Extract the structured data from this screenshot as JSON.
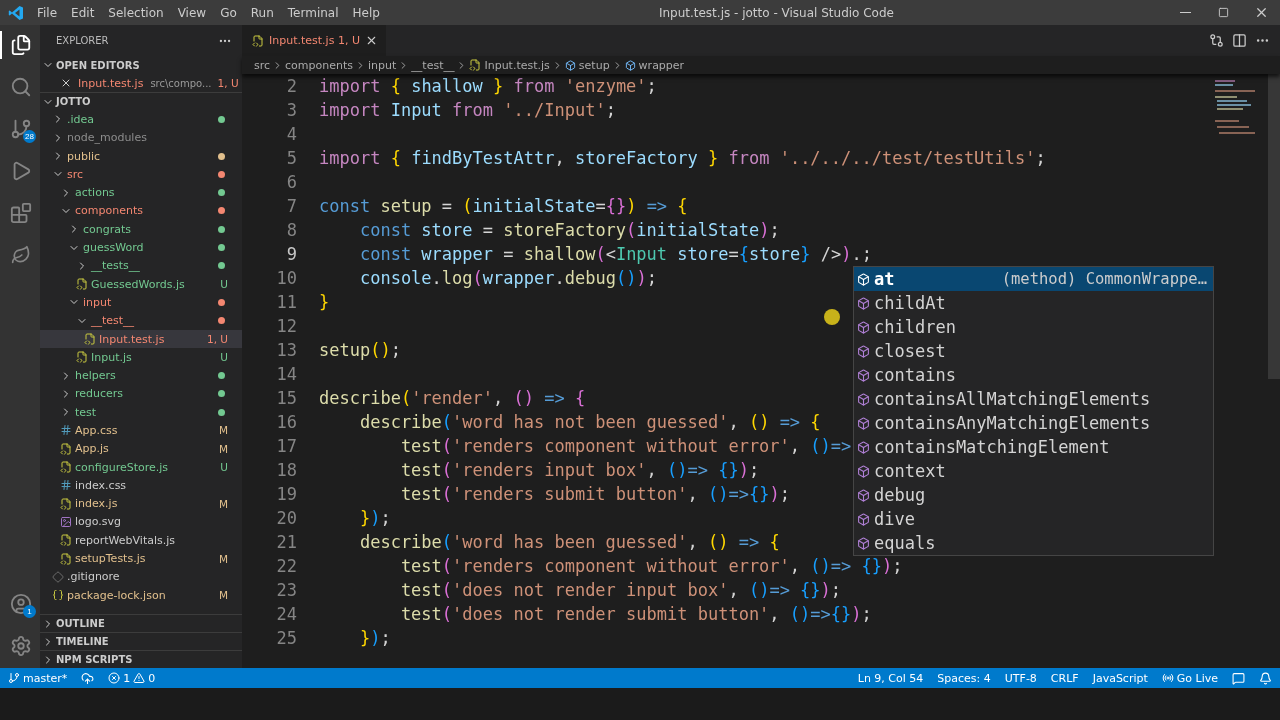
{
  "title_bar": {
    "menus": [
      "File",
      "Edit",
      "Selection",
      "View",
      "Go",
      "Run",
      "Terminal",
      "Help"
    ],
    "title": "Input.test.js - jotto - Visual Studio Code"
  },
  "activity_bar": {
    "source_control_badge": "28",
    "accounts_badge": "1"
  },
  "sidebar": {
    "title": "EXPLORER",
    "open_editors": {
      "label": "OPEN EDITORS",
      "expanded": true,
      "items": [
        {
          "name": "Input.test.js",
          "path": "src\\compo...",
          "badge": "1, U",
          "color": "#f48771"
        }
      ]
    },
    "project": {
      "label": "JOTTO",
      "expanded": true,
      "items": [
        {
          "name": ".idea",
          "kind": "folder",
          "expanded": false,
          "selected": false,
          "dot": true,
          "color": "#73c991"
        },
        {
          "name": "node_modules",
          "kind": "folder",
          "expanded": false,
          "selected": false,
          "dot": false,
          "color": "#8c8c8c"
        },
        {
          "name": "public",
          "kind": "folder",
          "expanded": false,
          "selected": false,
          "dot": true,
          "color": "#e2c08d"
        },
        {
          "name": "src",
          "kind": "folder",
          "expanded": true,
          "selected": false,
          "dot": true,
          "color": "#f48771",
          "children": [
            {
              "name": "actions",
              "kind": "folder",
              "expanded": false,
              "selected": false,
              "dot": true,
              "color": "#73c991"
            },
            {
              "name": "components",
              "kind": "folder",
              "expanded": true,
              "selected": false,
              "dot": true,
              "color": "#f48771",
              "children": [
                {
                  "name": "congrats",
                  "kind": "folder",
                  "expanded": false,
                  "selected": false,
                  "dot": true,
                  "color": "#73c991"
                },
                {
                  "name": "guessWord",
                  "kind": "folder",
                  "expanded": true,
                  "selected": false,
                  "dot": true,
                  "color": "#73c991",
                  "children": [
                    {
                      "name": "__tests__",
                      "kind": "folder",
                      "expanded": false,
                      "selected": false,
                      "dot": true,
                      "color": "#73c991"
                    },
                    {
                      "name": "GuessedWords.js",
                      "kind": "js",
                      "selected": false,
                      "dot": false,
                      "badge": "U",
                      "color": "#73c991"
                    }
                  ]
                },
                {
                  "name": "input",
                  "kind": "folder",
                  "expanded": true,
                  "selected": false,
                  "dot": true,
                  "color": "#f48771",
                  "children": [
                    {
                      "name": "__test__",
                      "kind": "folder",
                      "expanded": true,
                      "selected": false,
                      "dot": true,
                      "color": "#f48771",
                      "children": [
                        {
                          "name": "Input.test.js",
                          "kind": "js",
                          "selected": true,
                          "dot": false,
                          "badge": "1, U",
                          "color": "#f48771"
                        }
                      ]
                    },
                    {
                      "name": "Input.js",
                      "kind": "js",
                      "selected": false,
                      "dot": false,
                      "badge": "U",
                      "color": "#73c991"
                    }
                  ]
                }
              ]
            },
            {
              "name": "helpers",
              "kind": "folder",
              "expanded": false,
              "selected": false,
              "dot": true,
              "color": "#73c991"
            },
            {
              "name": "reducers",
              "kind": "folder",
              "expanded": false,
              "selected": false,
              "dot": true,
              "color": "#73c991"
            },
            {
              "name": "test",
              "kind": "folder",
              "expanded": false,
              "selected": false,
              "dot": true,
              "color": "#73c991"
            },
            {
              "name": "App.css",
              "kind": "css",
              "selected": false,
              "dot": false,
              "badge": "M",
              "color": "#e2c08d"
            },
            {
              "name": "App.js",
              "kind": "js",
              "selected": false,
              "dot": false,
              "badge": "M",
              "color": "#e2c08d"
            },
            {
              "name": "configureStore.js",
              "kind": "js",
              "selected": false,
              "dot": false,
              "badge": "U",
              "color": "#73c991"
            },
            {
              "name": "index.css",
              "kind": "css",
              "selected": false,
              "dot": false,
              "color": "#cccccc"
            },
            {
              "name": "index.js",
              "kind": "js",
              "selected": false,
              "dot": false,
              "badge": "M",
              "color": "#e2c08d"
            },
            {
              "name": "logo.svg",
              "kind": "svg",
              "selected": false,
              "dot": false,
              "color": "#cccccc"
            },
            {
              "name": "reportWebVitals.js",
              "kind": "js",
              "selected": false,
              "dot": false,
              "color": "#cccccc"
            },
            {
              "name": "setupTests.js",
              "kind": "js",
              "selected": false,
              "dot": false,
              "badge": "M",
              "color": "#e2c08d"
            }
          ]
        },
        {
          "name": ".gitignore",
          "kind": "git",
          "selected": false,
          "dot": false,
          "color": "#cccccc"
        },
        {
          "name": "package-lock.json",
          "kind": "json",
          "selected": false,
          "dot": false,
          "badge": "M",
          "color": "#e2c08d"
        }
      ]
    },
    "panels": [
      {
        "label": "OUTLINE",
        "expanded": false
      },
      {
        "label": "TIMELINE",
        "expanded": false
      },
      {
        "label": "NPM SCRIPTS",
        "expanded": false
      }
    ]
  },
  "tabs": [
    {
      "label": "Input.test.js",
      "badge": "1, U",
      "selected": true
    }
  ],
  "breadcrumbs": [
    {
      "label": "src",
      "kind": "folder"
    },
    {
      "label": "components",
      "kind": "folder"
    },
    {
      "label": "input",
      "kind": "folder"
    },
    {
      "label": "__test__",
      "kind": "folder"
    },
    {
      "label": "Input.test.js",
      "kind": "js"
    },
    {
      "label": "setup",
      "kind": "symbol"
    },
    {
      "label": "wrapper",
      "kind": "symbol"
    }
  ],
  "code_lines": [
    {
      "number": "2",
      "tokens": [
        {
          "kind": "kw",
          "text": "import "
        },
        {
          "kind": "b1",
          "text": "{"
        },
        {
          "kind": "var",
          "text": " shallow "
        },
        {
          "kind": "b1",
          "text": "}"
        },
        {
          "kind": "kw",
          "text": " from "
        },
        {
          "kind": "str",
          "text": "'enzyme'"
        },
        {
          "kind": "p",
          "text": ";"
        }
      ]
    },
    {
      "number": "3",
      "tokens": [
        {
          "kind": "kw",
          "text": "import"
        },
        {
          "kind": "var",
          "text": " Input "
        },
        {
          "kind": "kw",
          "text": "from "
        },
        {
          "kind": "str",
          "text": "'../Input'"
        },
        {
          "kind": "p",
          "text": ";"
        }
      ]
    },
    {
      "number": "4"
    },
    {
      "number": "5",
      "tokens": [
        {
          "kind": "kw",
          "text": "import "
        },
        {
          "kind": "b1",
          "text": "{"
        },
        {
          "kind": "var",
          "text": " findByTestAttr"
        },
        {
          "kind": "p",
          "text": ", "
        },
        {
          "kind": "var",
          "text": "storeFactory "
        },
        {
          "kind": "b1",
          "text": "}"
        },
        {
          "kind": "kw",
          "text": " from "
        },
        {
          "kind": "str",
          "text": "'../../../test/testUtils'"
        },
        {
          "kind": "p",
          "text": ";"
        }
      ]
    },
    {
      "number": "6"
    },
    {
      "number": "7",
      "tokens": [
        {
          "kind": "st",
          "text": "const "
        },
        {
          "kind": "fn",
          "text": "setup"
        },
        {
          "kind": "p",
          "text": " = "
        },
        {
          "kind": "b1",
          "text": "("
        },
        {
          "kind": "var",
          "text": "initialState"
        },
        {
          "kind": "p",
          "text": "="
        },
        {
          "kind": "b2",
          "text": "{}"
        },
        {
          "kind": "b1",
          "text": ")"
        },
        {
          "kind": "st",
          "text": " => "
        },
        {
          "kind": "b1",
          "text": "{"
        }
      ]
    },
    {
      "number": "8",
      "tokens": [
        {
          "kind": "st",
          "text": "    const"
        },
        {
          "kind": "var",
          "text": " store"
        },
        {
          "kind": "p",
          "text": " = "
        },
        {
          "kind": "fn",
          "text": "storeFactory"
        },
        {
          "kind": "b2",
          "text": "("
        },
        {
          "kind": "var",
          "text": "initialState"
        },
        {
          "kind": "b2",
          "text": ")"
        },
        {
          "kind": "p",
          "text": ";"
        }
      ]
    },
    {
      "number": "9",
      "tokens": [
        {
          "kind": "st",
          "text": "    const"
        },
        {
          "kind": "var",
          "text": " wrapper"
        },
        {
          "kind": "p",
          "text": " = "
        },
        {
          "kind": "fn",
          "text": "shallow"
        },
        {
          "kind": "b2",
          "text": "("
        },
        {
          "kind": "p",
          "text": "<"
        },
        {
          "kind": "tag",
          "text": "Input"
        },
        {
          "kind": "var",
          "text": " store"
        },
        {
          "kind": "p",
          "text": "="
        },
        {
          "kind": "b3",
          "text": "{"
        },
        {
          "kind": "var",
          "text": "store"
        },
        {
          "kind": "b3",
          "text": "}"
        },
        {
          "kind": "p",
          "text": " />"
        },
        {
          "kind": "b2",
          "text": ")"
        },
        {
          "kind": "p",
          "text": ".;"
        }
      ]
    },
    {
      "number": "10",
      "tokens": [
        {
          "kind": "var",
          "text": "    console"
        },
        {
          "kind": "p",
          "text": "."
        },
        {
          "kind": "fn",
          "text": "log"
        },
        {
          "kind": "b2",
          "text": "("
        },
        {
          "kind": "var",
          "text": "wrapper"
        },
        {
          "kind": "p",
          "text": "."
        },
        {
          "kind": "fn",
          "text": "debug"
        },
        {
          "kind": "b3",
          "text": "()"
        },
        {
          "kind": "b2",
          "text": ")"
        },
        {
          "kind": "p",
          "text": ";"
        }
      ]
    },
    {
      "number": "11",
      "tokens": [
        {
          "kind": "b1",
          "text": "}"
        }
      ]
    },
    {
      "number": "12"
    },
    {
      "number": "13",
      "tokens": [
        {
          "kind": "fn",
          "text": "setup"
        },
        {
          "kind": "b1",
          "text": "()"
        },
        {
          "kind": "p",
          "text": ";"
        }
      ]
    },
    {
      "number": "14"
    },
    {
      "number": "15",
      "tokens": [
        {
          "kind": "fn",
          "text": "describe"
        },
        {
          "kind": "b1",
          "text": "("
        },
        {
          "kind": "str",
          "text": "'render'"
        },
        {
          "kind": "p",
          "text": ", "
        },
        {
          "kind": "b2",
          "text": "()"
        },
        {
          "kind": "st",
          "text": " => "
        },
        {
          "kind": "b2",
          "text": "{"
        }
      ]
    },
    {
      "number": "16",
      "tokens": [
        {
          "kind": "fn",
          "text": "    describe"
        },
        {
          "kind": "b3",
          "text": "("
        },
        {
          "kind": "str",
          "text": "'word has not been guessed'"
        },
        {
          "kind": "p",
          "text": ", "
        },
        {
          "kind": "b1",
          "text": "()"
        },
        {
          "kind": "st",
          "text": " => "
        },
        {
          "kind": "b1",
          "text": "{"
        }
      ]
    },
    {
      "number": "17",
      "tokens": [
        {
          "kind": "fn",
          "text": "        test"
        },
        {
          "kind": "b2",
          "text": "("
        },
        {
          "kind": "str",
          "text": "'renders component without error'"
        },
        {
          "kind": "p",
          "text": ", "
        },
        {
          "kind": "b3",
          "text": "()"
        },
        {
          "kind": "st",
          "text": "=>"
        }
      ]
    },
    {
      "number": "18",
      "tokens": [
        {
          "kind": "fn",
          "text": "        test"
        },
        {
          "kind": "b2",
          "text": "("
        },
        {
          "kind": "str",
          "text": "'renders input box'"
        },
        {
          "kind": "p",
          "text": ", "
        },
        {
          "kind": "b3",
          "text": "()"
        },
        {
          "kind": "st",
          "text": "=> "
        },
        {
          "kind": "b3",
          "text": "{}"
        },
        {
          "kind": "b2",
          "text": ")"
        },
        {
          "kind": "p",
          "text": ";"
        }
      ]
    },
    {
      "number": "19",
      "tokens": [
        {
          "kind": "fn",
          "text": "        test"
        },
        {
          "kind": "b2",
          "text": "("
        },
        {
          "kind": "str",
          "text": "'renders submit button'"
        },
        {
          "kind": "p",
          "text": ", "
        },
        {
          "kind": "b3",
          "text": "()"
        },
        {
          "kind": "st",
          "text": "=>"
        },
        {
          "kind": "b3",
          "text": "{}"
        },
        {
          "kind": "b2",
          "text": ")"
        },
        {
          "kind": "p",
          "text": ";"
        }
      ]
    },
    {
      "number": "20",
      "tokens": [
        {
          "kind": "b1",
          "text": "    }"
        },
        {
          "kind": "b3",
          "text": ")"
        },
        {
          "kind": "p",
          "text": ";"
        }
      ]
    },
    {
      "number": "21",
      "tokens": [
        {
          "kind": "fn",
          "text": "    describe"
        },
        {
          "kind": "b3",
          "text": "("
        },
        {
          "kind": "str",
          "text": "'word has been guessed'"
        },
        {
          "kind": "p",
          "text": ", "
        },
        {
          "kind": "b1",
          "text": "()"
        },
        {
          "kind": "st",
          "text": " => "
        },
        {
          "kind": "b1",
          "text": "{"
        }
      ]
    },
    {
      "number": "22",
      "tokens": [
        {
          "kind": "fn",
          "text": "        test"
        },
        {
          "kind": "b2",
          "text": "("
        },
        {
          "kind": "str",
          "text": "'renders component without error'"
        },
        {
          "kind": "p",
          "text": ", "
        },
        {
          "kind": "b3",
          "text": "()"
        },
        {
          "kind": "st",
          "text": "=> "
        },
        {
          "kind": "b3",
          "text": "{}"
        },
        {
          "kind": "b2",
          "text": ")"
        },
        {
          "kind": "p",
          "text": ";"
        }
      ]
    },
    {
      "number": "23",
      "tokens": [
        {
          "kind": "fn",
          "text": "        test"
        },
        {
          "kind": "b2",
          "text": "("
        },
        {
          "kind": "str",
          "text": "'does not render input box'"
        },
        {
          "kind": "p",
          "text": ", "
        },
        {
          "kind": "b3",
          "text": "()"
        },
        {
          "kind": "st",
          "text": "=> "
        },
        {
          "kind": "b3",
          "text": "{}"
        },
        {
          "kind": "b2",
          "text": ")"
        },
        {
          "kind": "p",
          "text": ";"
        }
      ]
    },
    {
      "number": "24",
      "tokens": [
        {
          "kind": "fn",
          "text": "        test"
        },
        {
          "kind": "b2",
          "text": "("
        },
        {
          "kind": "str",
          "text": "'does not render submit button'"
        },
        {
          "kind": "p",
          "text": ", "
        },
        {
          "kind": "b3",
          "text": "()"
        },
        {
          "kind": "st",
          "text": "=>"
        },
        {
          "kind": "b3",
          "text": "{}"
        },
        {
          "kind": "b2",
          "text": ")"
        },
        {
          "kind": "p",
          "text": ";"
        }
      ]
    },
    {
      "number": "25",
      "tokens": [
        {
          "kind": "b1",
          "text": "    }"
        },
        {
          "kind": "b3",
          "text": ")"
        },
        {
          "kind": "p",
          "text": ";"
        }
      ]
    }
  ],
  "suggestions": [
    {
      "label": "at",
      "detail": "(method) CommonWrappe…",
      "selected": true
    },
    {
      "label": "childAt",
      "selected": false
    },
    {
      "label": "children",
      "selected": false
    },
    {
      "label": "closest",
      "selected": false
    },
    {
      "label": "contains",
      "selected": false
    },
    {
      "label": "containsAllMatchingElements",
      "selected": false
    },
    {
      "label": "containsAnyMatchingElements",
      "selected": false
    },
    {
      "label": "containsMatchingElement",
      "selected": false
    },
    {
      "label": "context",
      "selected": false
    },
    {
      "label": "debug",
      "selected": false
    },
    {
      "label": "dive",
      "selected": false
    },
    {
      "label": "equals",
      "selected": false
    }
  ],
  "status_bar": {
    "branch": "master*",
    "errors": "1",
    "warnings": "0",
    "right": [
      "Ln 9, Col 54",
      "Spaces: 4",
      "UTF-8",
      "CRLF",
      "JavaScript"
    ],
    "go_live": "Go Live"
  }
}
